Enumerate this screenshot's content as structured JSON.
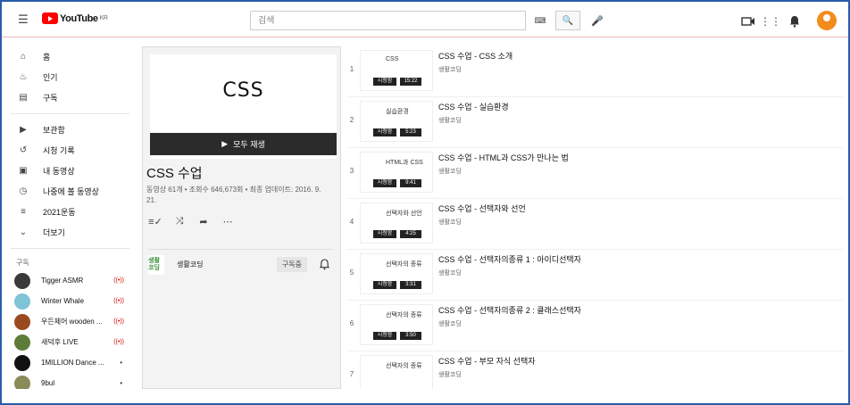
{
  "header": {
    "logo_text": "YouTube",
    "logo_region": "KR",
    "search_placeholder": "검색"
  },
  "sidebar": {
    "main": [
      {
        "label": "홈",
        "icon": "home-icon"
      },
      {
        "label": "인기",
        "icon": "flame-icon"
      },
      {
        "label": "구독",
        "icon": "subscriptions-icon"
      }
    ],
    "library": [
      {
        "label": "보관함",
        "icon": "library-icon"
      },
      {
        "label": "시청 기록",
        "icon": "history-icon"
      },
      {
        "label": "내 동영상",
        "icon": "my-videos-icon"
      },
      {
        "label": "나중에 볼 동영상",
        "icon": "watch-later-icon"
      },
      {
        "label": "2021운동",
        "icon": "playlist-icon"
      },
      {
        "label": "더보기",
        "icon": "chevron-down-icon"
      }
    ],
    "subs_header": "구독",
    "subscriptions": [
      {
        "name": "Tigger ASMR",
        "status": "live",
        "color": "#3a3a3a"
      },
      {
        "name": "Winter Whale",
        "status": "live",
        "color": "#7fc3d6"
      },
      {
        "name": "우든체어 wooden ...",
        "status": "live",
        "color": "#9a4a1f"
      },
      {
        "name": "새덕후 LIVE",
        "status": "live",
        "color": "#5c7d3a"
      },
      {
        "name": "1MILLION Dance ...",
        "status": "dot",
        "color": "#111111"
      },
      {
        "name": "9bul",
        "status": "dot",
        "color": "#8a8a5a"
      }
    ]
  },
  "playlist": {
    "thumb_text": "CSS",
    "play_all": "모두 재생",
    "title": "CSS 수업",
    "meta": "동영상 61개 • 조회수 646,673회 • 최종 업데이트: 2016. 9. 21.",
    "owner_badge": "생활코딩",
    "owner_name": "생활코딩",
    "subscribe_label": "구독중"
  },
  "videos": [
    {
      "index": "1",
      "title": "CSS 수업 - CSS 소개",
      "channel": "생활코딩",
      "thumb_caption": "CSS",
      "left_badge": "시청함",
      "right_badge": "15:22"
    },
    {
      "index": "2",
      "title": "CSS 수업 - 실습환경",
      "channel": "생활코딩",
      "thumb_caption": "실습환경",
      "left_badge": "시청함",
      "right_badge": "5:23"
    },
    {
      "index": "3",
      "title": "CSS 수업 - HTML과 CSS가 만나는 법",
      "channel": "생활코딩",
      "thumb_caption": "HTML과 CSS",
      "left_badge": "시청함",
      "right_badge": "9:41"
    },
    {
      "index": "4",
      "title": "CSS 수업 - 선택자와 선언",
      "channel": "생활코딩",
      "thumb_caption": "선택자와 선언",
      "left_badge": "시청함",
      "right_badge": "4:25"
    },
    {
      "index": "5",
      "title": "CSS 수업 - 선택자의종류 1 : 아이디선택자",
      "channel": "생활코딩",
      "thumb_caption": "선택자의 종류",
      "left_badge": "시청함",
      "right_badge": "3:31"
    },
    {
      "index": "6",
      "title": "CSS 수업 - 선택자의종류 2 : 클래스선택자",
      "channel": "생활코딩",
      "thumb_caption": "선택자의 종류",
      "left_badge": "시청함",
      "right_badge": "3:50"
    },
    {
      "index": "7",
      "title": "CSS 수업 - 부모 자식 선택자",
      "channel": "생활코딩",
      "thumb_caption": "선택자의 종류",
      "left_badge": "",
      "right_badge": ""
    }
  ]
}
